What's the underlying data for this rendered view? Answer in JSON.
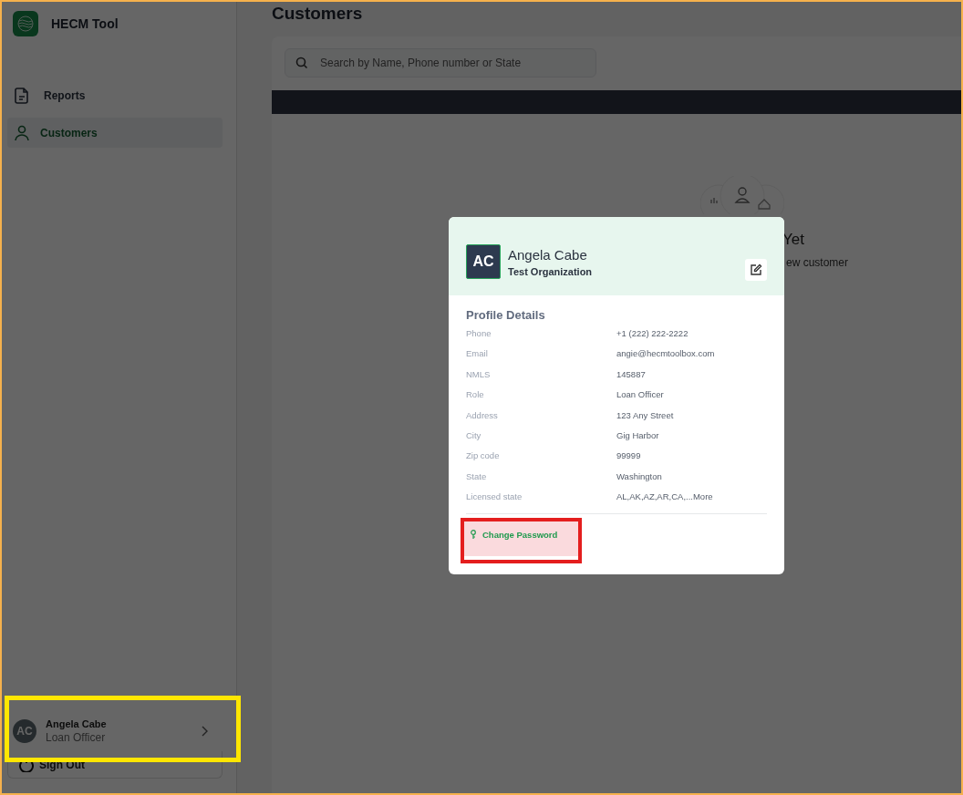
{
  "app": {
    "name": "HECM Tool"
  },
  "sidebar": {
    "items": [
      {
        "label": "Reports",
        "kind": "reports",
        "selected": false
      },
      {
        "label": "Customers",
        "kind": "customers",
        "selected": true
      }
    ],
    "user": {
      "initials": "AC",
      "name": "Angela Cabe",
      "role": "Loan Officer"
    },
    "sign_out": "Sign Out"
  },
  "page": {
    "title": "Customers",
    "search": {
      "placeholder": "Search by Name, Phone number or State"
    },
    "empty_state": {
      "title": "Yet",
      "text": "ew customer"
    }
  },
  "profile_modal": {
    "initials": "AC",
    "name": "Angela Cabe",
    "organization": "Test Organization",
    "section_title": "Profile Details",
    "fields": [
      {
        "label": "Phone",
        "value": "+1 (222) 222-2222"
      },
      {
        "label": "Email",
        "value": "angie@hecmtoolbox.com"
      },
      {
        "label": "NMLS",
        "value": "145887"
      },
      {
        "label": "Role",
        "value": "Loan Officer"
      },
      {
        "label": "Address",
        "value": "123 Any Street"
      },
      {
        "label": "City",
        "value": "Gig Harbor"
      },
      {
        "label": "Zip code",
        "value": "99999"
      },
      {
        "label": "State",
        "value": "Washington"
      },
      {
        "label": "Licensed state",
        "value": "AL,AK,AZ,AR,CA,...More"
      }
    ],
    "change_password": "Change Password"
  }
}
